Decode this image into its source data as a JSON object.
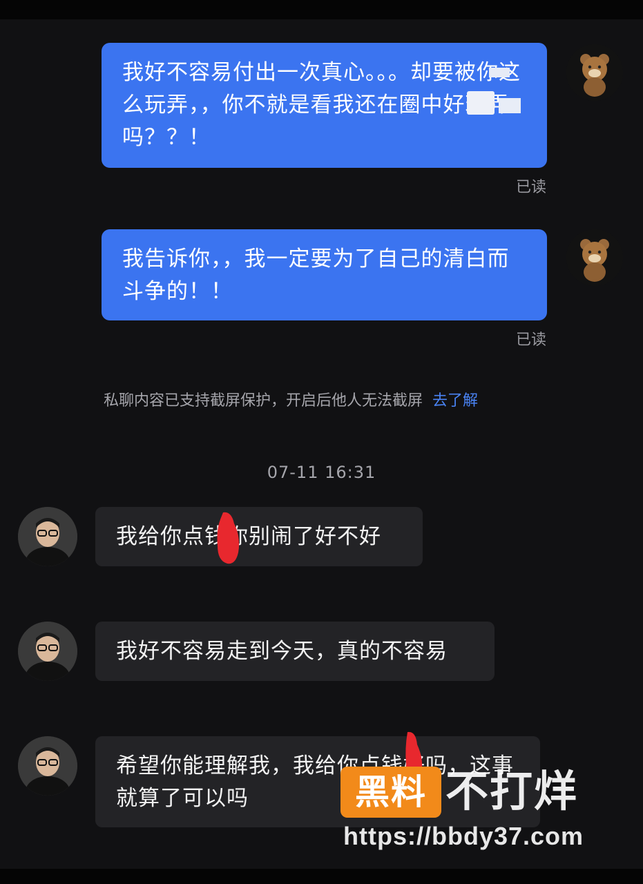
{
  "messages_out": [
    {
      "text": "我好不容易付出一次真心。。。却要被你这么玩弄，，你不就是看我还在圈中好玩弄吗？？！",
      "status": "已读"
    },
    {
      "text": "我告诉你，，我一定要为了自己的清白而斗争的！！",
      "status": "已读"
    }
  ],
  "notice": {
    "text": "私聊内容已支持截屏保护，开启后他人无法截屏",
    "link": "去了解"
  },
  "timestamp": "07-11 16:31",
  "messages_in": [
    {
      "text": "我给你点钱你别闹了好不好"
    },
    {
      "text": "我好不容易走到今天，真的不容易"
    },
    {
      "text": "希望你能理解我，我给你点钱好吗，这事就算了可以吗"
    }
  ],
  "watermark": {
    "badge": "黑料",
    "title": "不打烊",
    "url": "https://bbdy37.com"
  },
  "colors": {
    "bubble_out": "#3b74f0",
    "bubble_in": "#232326",
    "link": "#4a84f5",
    "badge": "#f28a1a"
  }
}
